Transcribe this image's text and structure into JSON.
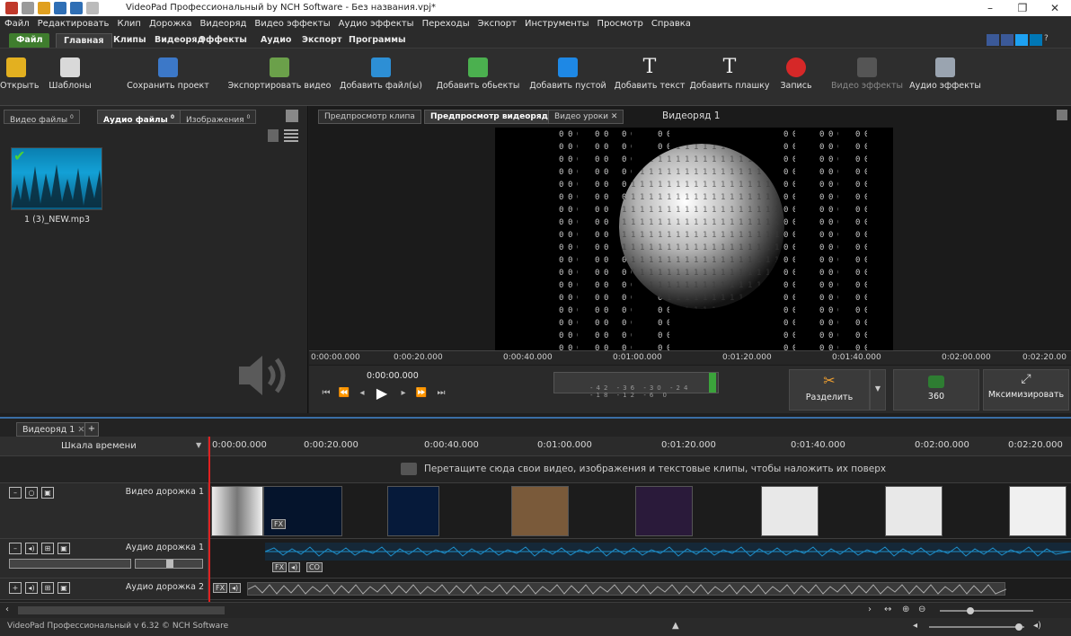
{
  "window": {
    "title": "VideoPad Профессиональный by NCH Software - Без названия.vpj*",
    "controls": [
      "–",
      "❐",
      "✕"
    ]
  },
  "menubar": [
    "Файл",
    "Редактировать",
    "Клип",
    "Дорожка",
    "Видеоряд",
    "Видео эффекты",
    "Аудио эффекты",
    "Переходы",
    "Экспорт",
    "Инструменты",
    "Просмотр",
    "Справка"
  ],
  "ribbon_tabs": [
    "Файл",
    "Главная",
    "Клипы",
    "Видеоряд",
    "Эффекты",
    "Аудио",
    "Экспорт",
    "Программы"
  ],
  "toolbar": {
    "open": "Открыть",
    "templates": "Шаблоны",
    "save_project": "Сохранить проект",
    "export_video": "Экспортировать видео",
    "add_files": "Добавить файл(ы)",
    "add_objects": "Добавить обьекты",
    "add_blank": "Добавить пустой",
    "add_text": "Добавить текст",
    "add_title": "Добавить плашку",
    "record": "Запись",
    "video_effects": "Видео эффекты",
    "audio_effects": "Аудио эффекты"
  },
  "bin": {
    "tabs": [
      "Видео файлы",
      "Аудио файлы",
      "Изображения"
    ],
    "tab_counts": [
      "0",
      "0",
      "0"
    ],
    "clip_name": "1 (3)_NEW.mp3"
  },
  "preview": {
    "tabs": [
      "Предпросмотр клипа",
      "Предпросмотр видеоряда",
      "Видео уроки"
    ],
    "close": "✕",
    "title": "Видеоряд 1",
    "ruler": [
      "0:00:00.000",
      "0:00:20.000",
      "0:00:40.000",
      "0:01:00.000",
      "0:01:20.000",
      "0:01:40.000",
      "0:02:00.000",
      "0:02:20.00"
    ],
    "timecode": "0:00:00.000",
    "meter_scale": "-42 -36 -30 -24 -18 -12 -6 0",
    "split": "Разделить",
    "vr": "360",
    "maximize": "Мксимизировать"
  },
  "sequence": {
    "tab": "Видеоряд 1",
    "close": "✕",
    "add": "+",
    "scale_label": "Шкала времени",
    "ticks": [
      "0:00:00.000",
      "0:00:20.000",
      "0:00:40.000",
      "0:01:00.000",
      "0:01:20.000",
      "0:01:40.000",
      "0:02:00.000",
      "0:02:20.000"
    ],
    "overlay_hint": "Перетащите сюда свои видео, изображения и текстовые клипы, чтобы наложить их поверх"
  },
  "tracks": {
    "video1": "Видео дорожка 1",
    "audio1": "Аудио дорожка 1",
    "audio2": "Аудио дорожка 2",
    "fx": "FX",
    "co": "CO"
  },
  "status": {
    "text": "VideoPad Профессиональный v 6.32 © NCH Software"
  },
  "colors": {
    "accent_green": "#3f7d2e",
    "playhead": "#e02020",
    "waveform": "#1e8ec9"
  }
}
